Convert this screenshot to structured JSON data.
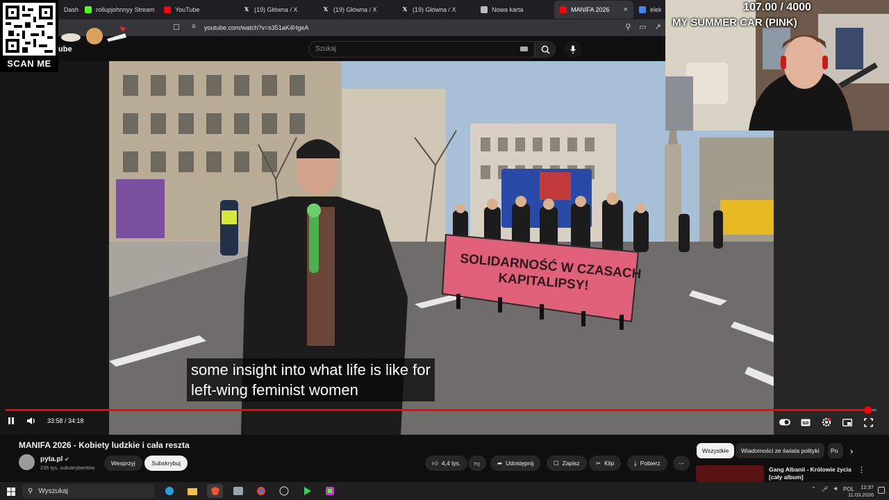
{
  "browser": {
    "tabs": [
      {
        "label": "Dash",
        "icon": "dashboard-icon",
        "color": "#6a8cff"
      },
      {
        "label": "rollupjohnnyy Stream",
        "icon": "kick-icon",
        "color": "#53fc18"
      },
      {
        "label": "YouTube",
        "icon": "youtube-icon",
        "color": "#ff0000"
      },
      {
        "label": "(19) Główna / X",
        "icon": "x-icon",
        "color": "#ffffff"
      },
      {
        "label": "(19) Główna / X",
        "icon": "x-icon",
        "color": "#ffffff"
      },
      {
        "label": "(19) Główna / X",
        "icon": "x-icon",
        "color": "#ffffff"
      },
      {
        "label": "Nowa karta",
        "icon": "new-tab-icon",
        "color": "#bbbbbb"
      },
      {
        "label": "MANIFA 2026",
        "icon": "youtube-icon",
        "color": "#ff0000",
        "active": true
      },
      {
        "label": "elektr",
        "icon": "google-icon",
        "color": "#4285f4"
      }
    ],
    "url": "youtube.com/watch?v=s351aK4HgeA"
  },
  "overlay": {
    "qr_label": "SCAN ME",
    "counter": "107.00 / 4000",
    "game": "MY SUMMER CAR (PINK)"
  },
  "youtube": {
    "logo": "ube",
    "search_placeholder": "Szukaj"
  },
  "player": {
    "captions": [
      "some insight into what life is like for",
      "left-wing feminist women"
    ],
    "time": "33:58 / 34:18",
    "progress": 0.99,
    "banner_text": [
      "SOLIDARNOŚĆ W CZASACH",
      "KAPITALIPSY!"
    ]
  },
  "video_info": {
    "title": "MANIFA 2026 - Kobiety ludzkie i cała reszta",
    "channel": "pyta.pl",
    "subscribers": "235 tys. subskrybentów",
    "support_label": "Wesprzyj",
    "subscribe_label": "Subskrybuj",
    "likes": "4,4 tys.",
    "share_label": "Udostępnij",
    "save_label": "Zapisz",
    "clip_label": "Klip",
    "download_label": "Pobierz"
  },
  "recommendations": {
    "chips": [
      "Wszystkie",
      "Wiadomości ze świata polityki",
      "Po"
    ],
    "first_title": "Gang Albanii - Królowie życia [cały album]"
  },
  "taskbar": {
    "search": "Wyszukaj",
    "lang": "POL",
    "time": "12:37",
    "date": "11.03.2026"
  },
  "colors": {
    "accent": "#ff0000",
    "banner": "#e0607a"
  }
}
